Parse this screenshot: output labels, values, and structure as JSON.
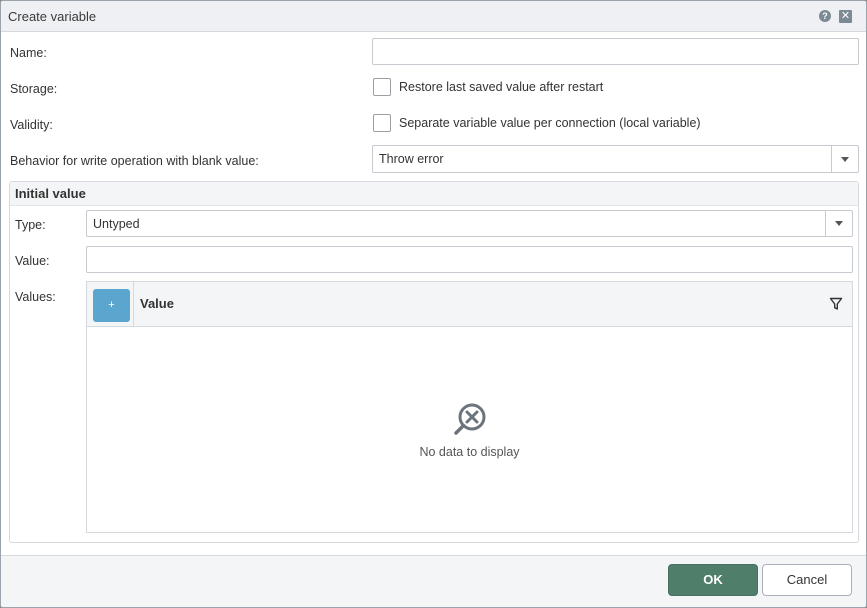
{
  "dialog": {
    "title": "Create variable",
    "help_icon": "help-icon",
    "close_icon": "close-icon"
  },
  "form": {
    "name_label": "Name:",
    "name_value": "",
    "storage_label": "Storage:",
    "storage_checkbox_label": "Restore last saved value after restart",
    "storage_checked": false,
    "validity_label": "Validity:",
    "validity_checkbox_label": "Separate variable value per connection (local variable)",
    "validity_checked": false,
    "behavior_label": "Behavior for write operation with blank value:",
    "behavior_value": "Throw error"
  },
  "initial_value": {
    "section_title": "Initial value",
    "type_label": "Type:",
    "type_value": "Untyped",
    "value_label": "Value:",
    "value_value": "",
    "values_label": "Values:",
    "grid": {
      "add_button_label": "+",
      "column_header": "Value",
      "filter_icon": "filter-icon",
      "empty_icon": "no-data-icon",
      "empty_text": "No data to display",
      "rows": []
    }
  },
  "footer": {
    "ok_label": "OK",
    "cancel_label": "Cancel"
  },
  "colors": {
    "accent_primary": "#4f7f6a",
    "add_button": "#5aa6cf",
    "icon_gray": "#7b8a93"
  }
}
